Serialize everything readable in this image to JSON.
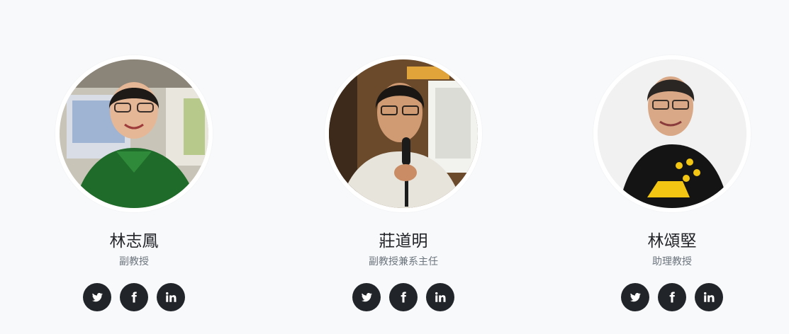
{
  "team": [
    {
      "name": "林志鳳",
      "title": "副教授"
    },
    {
      "name": "莊道明",
      "title": "副教授兼系主任"
    },
    {
      "name": "林頌堅",
      "title": "助理教授"
    }
  ],
  "social_icons": [
    "twitter-icon",
    "facebook-icon",
    "linkedin-icon"
  ],
  "colors": {
    "background": "#f8f9fb",
    "button": "#212529",
    "name_text": "#222428",
    "title_text": "#6c757d",
    "avatar_border": "#ffffff"
  }
}
